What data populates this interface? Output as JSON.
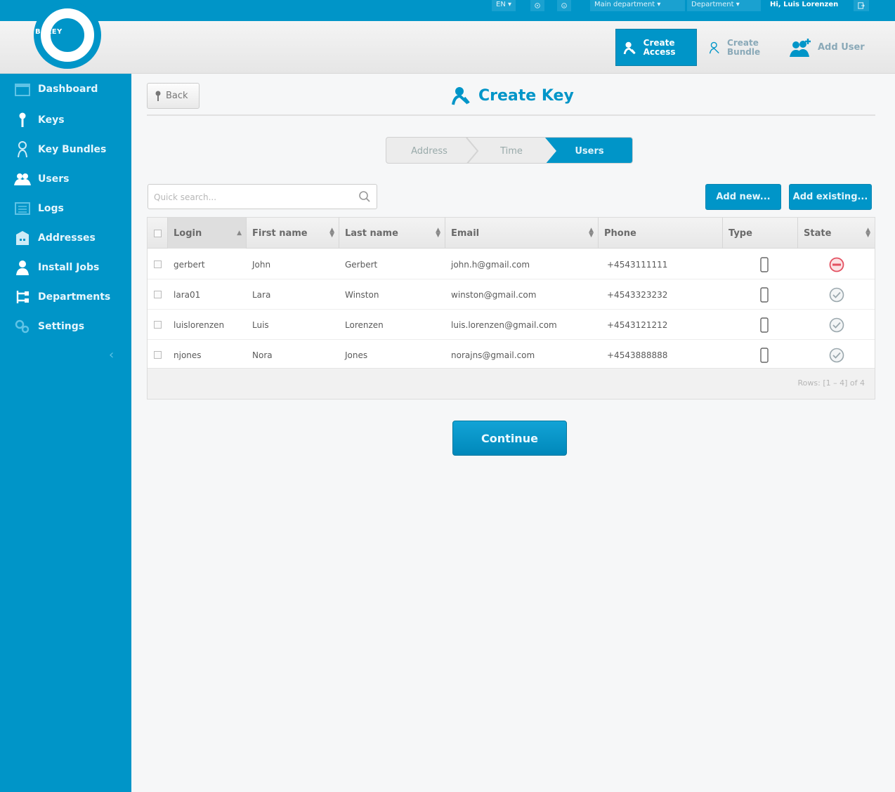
{
  "topbar": {
    "language": "EN ▾",
    "department_1": "Main department",
    "department_2": "Department",
    "user": "Hi, Luis Lorenzen"
  },
  "header": {
    "logo_text": "BEKEY",
    "create_access": "Create Access",
    "create_bundle": "Create Bundle",
    "add_user": "Add User"
  },
  "sidebar": {
    "items": [
      {
        "label": "Dashboard",
        "icon": "calendar-icon"
      },
      {
        "label": "Keys",
        "icon": "key-icon"
      },
      {
        "label": "Key Bundles",
        "icon": "key-bundle-icon"
      },
      {
        "label": "Users",
        "icon": "users-icon"
      },
      {
        "label": "Logs",
        "icon": "list-icon"
      },
      {
        "label": "Addresses",
        "icon": "building-icon"
      },
      {
        "label": "Install Jobs",
        "icon": "installer-icon"
      },
      {
        "label": "Departments",
        "icon": "departments-icon"
      },
      {
        "label": "Settings",
        "icon": "settings-icon"
      }
    ],
    "collapse": "‹"
  },
  "main": {
    "back": "Back",
    "title": "Create Key",
    "steps": [
      "Address",
      "Time",
      "Users"
    ],
    "search_placeholder": "Quick search...",
    "add_new": "Add new...",
    "add_existing": "Add existing...",
    "continue": "Continue"
  },
  "table": {
    "columns": [
      "Login",
      "First name",
      "Last name",
      "Email",
      "Phone",
      "Type",
      "State"
    ],
    "rows": [
      {
        "login": "gerbert",
        "first": "John",
        "last": "Gerbert",
        "email": "john.h@gmail.com",
        "phone": "+4543111111",
        "type": "phone",
        "state": "blocked"
      },
      {
        "login": "lara01",
        "first": "Lara",
        "last": "Winston",
        "email": "winston@gmail.com",
        "phone": "+4543323232",
        "type": "phone",
        "state": "ok"
      },
      {
        "login": "luislorenzen",
        "first": "Luis",
        "last": "Lorenzen",
        "email": "luis.lorenzen@gmail.com",
        "phone": "+4543121212",
        "type": "phone",
        "state": "ok"
      },
      {
        "login": "njones",
        "first": "Nora",
        "last": "Jones",
        "email": "norajns@gmail.com",
        "phone": "+4543888888",
        "type": "phone",
        "state": "ok"
      }
    ],
    "footer": "Rows: [1 – 4] of 4"
  },
  "colors": {
    "primary": "#0095c8",
    "state_blocked": "#e35060",
    "state_ok": "#9aa7ad"
  }
}
